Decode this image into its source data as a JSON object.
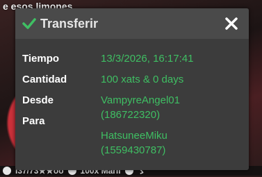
{
  "background": {
    "title_partial": "e esos limones",
    "bottom_items": [
      "i37/73★★oo",
      "100x Maril",
      "ゞ"
    ]
  },
  "dialog": {
    "title": "Transferir",
    "icons": {
      "check": "check-icon",
      "close": "close-icon"
    },
    "labels": {
      "time": "Tiempo",
      "amount": "Cantidad",
      "from": "Desde",
      "to": "Para"
    },
    "values": {
      "time": "13/3/2026, 16:17:41",
      "amount": "100 xats & 0 days",
      "from_name": "VampyreAngel01",
      "from_id": "(186722320)",
      "to_name": "HatsuneeMiku",
      "to_id": "(1559430787)"
    },
    "colors": {
      "accent_green": "#3fbf63",
      "panel": "#3c3c3c",
      "header": "#4a4a4a"
    }
  }
}
